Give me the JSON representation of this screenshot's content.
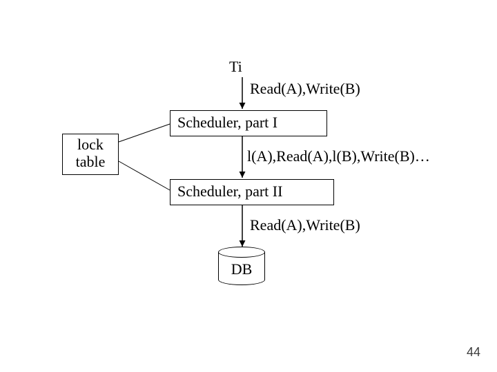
{
  "labels": {
    "ti": "Ti",
    "top_ops": "Read(A),Write(B)",
    "scheduler1": "Scheduler, part I",
    "mid_ops": "l(A),Read(A),l(B),Write(B)…",
    "scheduler2": "Scheduler, part II",
    "bottom_ops": "Read(A),Write(B)",
    "lock_table": "lock table",
    "db": "DB"
  },
  "slide_number": "44"
}
